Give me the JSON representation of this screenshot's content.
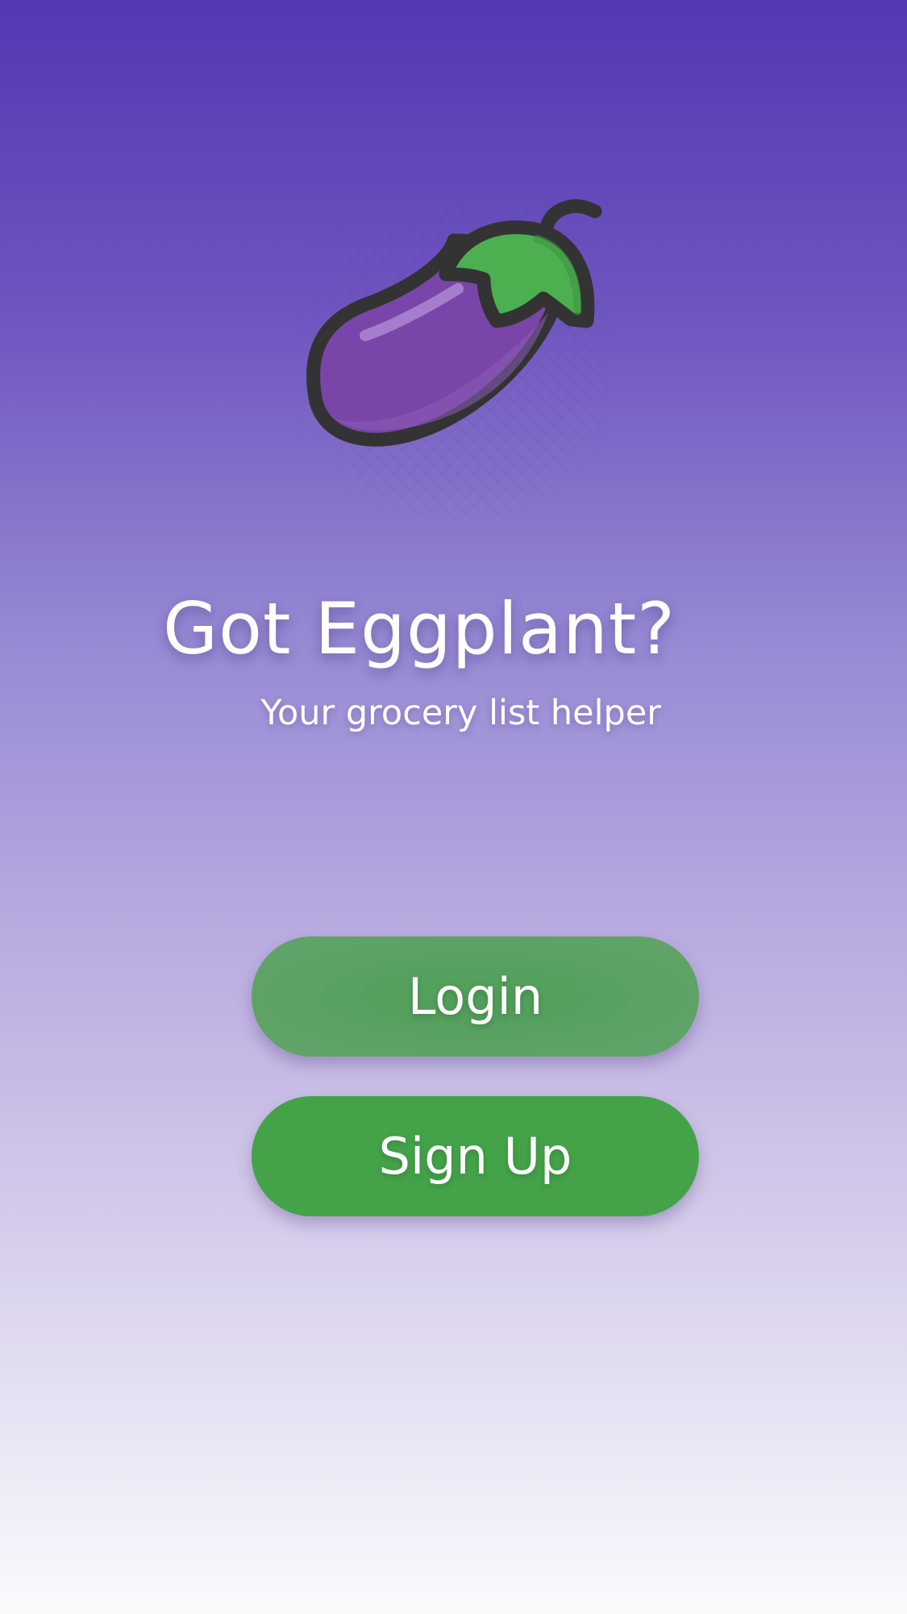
{
  "app": {
    "title": "Got Eggplant?",
    "subtitle": "Your grocery list helper"
  },
  "logo": {
    "icon": "eggplant-icon"
  },
  "actions": {
    "login_label": "Login",
    "signup_label": "Sign Up"
  },
  "colors": {
    "gradient_top": "#5437b4",
    "gradient_bottom": "#fbfafd",
    "login_button": "#5ea266",
    "signup_button": "#44a349",
    "eggplant_body": "#7a45a8",
    "eggplant_cap": "#4caf50",
    "outline": "#333333"
  }
}
